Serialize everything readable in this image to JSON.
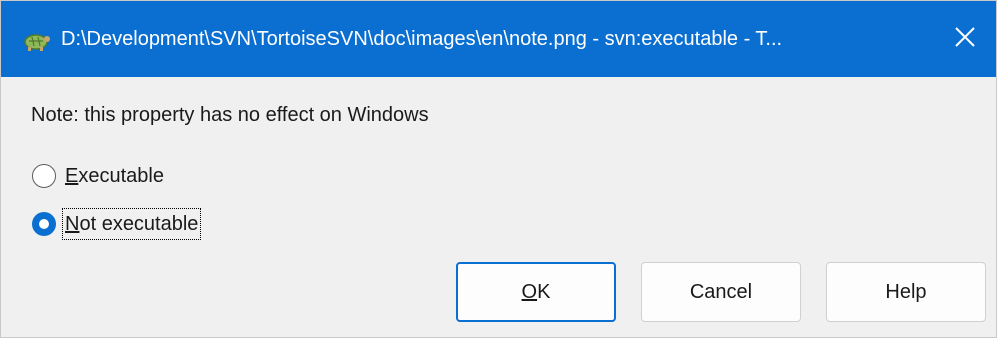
{
  "window": {
    "title": "D:\\Development\\SVN\\TortoiseSVN\\doc\\images\\en\\note.png - svn:executable - T...",
    "icon": "tortoise-icon",
    "close_icon": "close-icon",
    "accent_color": "#0a6fd0"
  },
  "note_text": "Note: this property has no effect on Windows",
  "options": [
    {
      "label_mnemonic": "E",
      "label_rest": "xecutable",
      "selected": false
    },
    {
      "label_mnemonic": "N",
      "label_rest": "ot executable",
      "selected": true
    }
  ],
  "buttons": {
    "ok_mnemonic": "O",
    "ok_rest": "K",
    "cancel": "Cancel",
    "help": "Help"
  }
}
